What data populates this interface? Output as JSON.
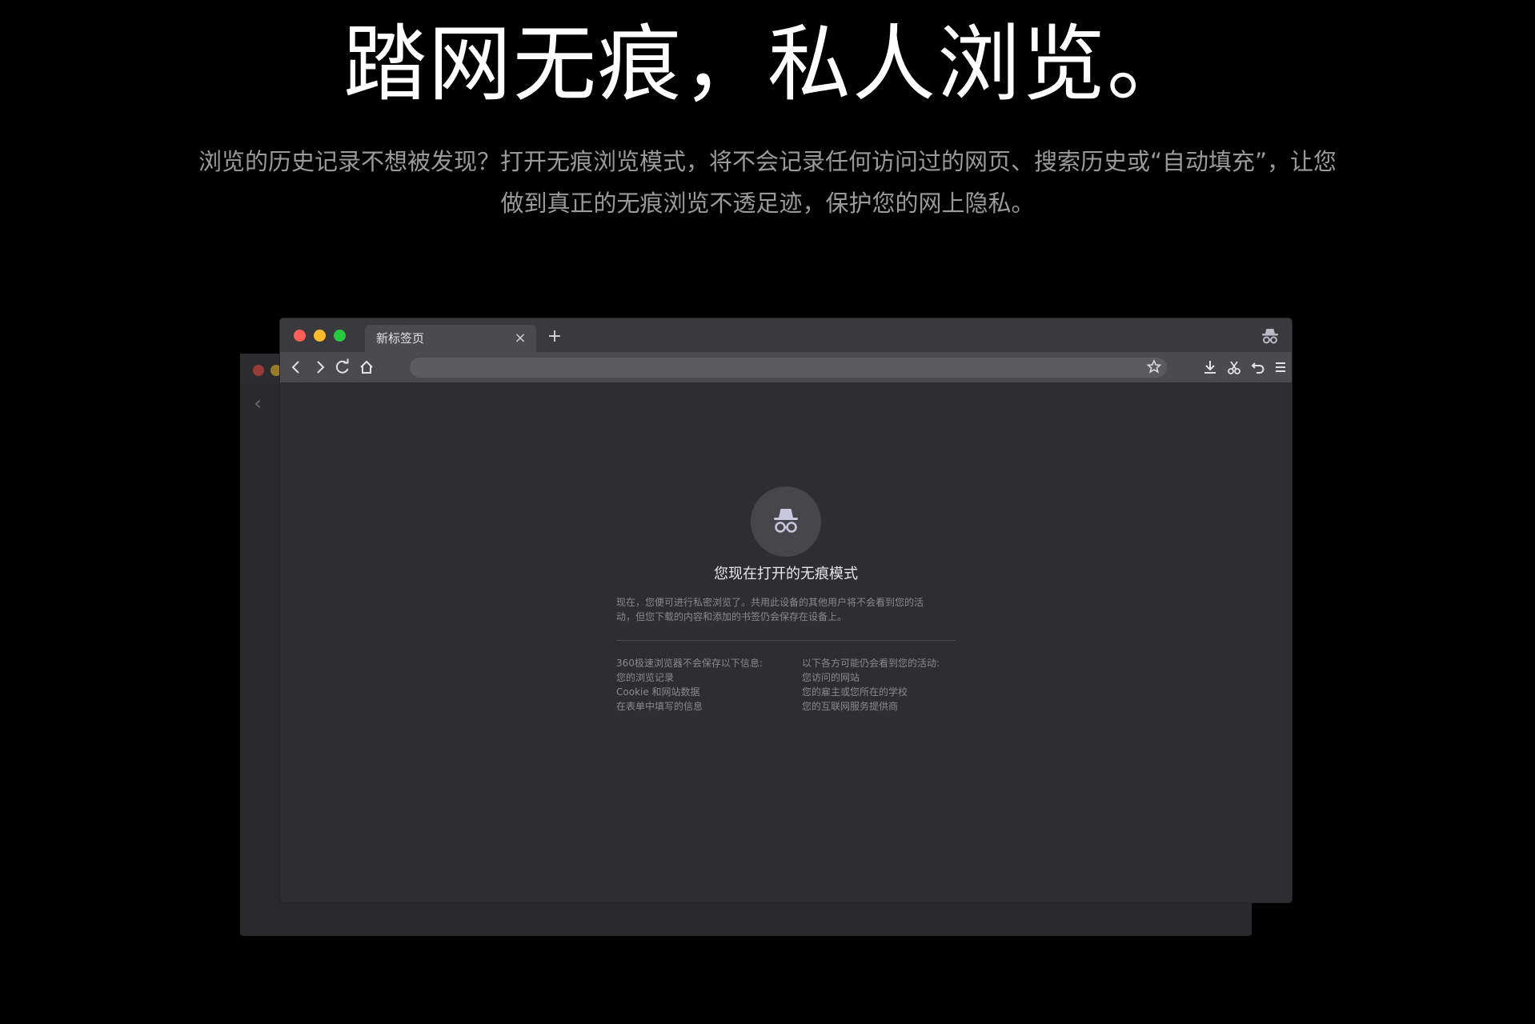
{
  "hero": {
    "headline": "踏网无痕，私人浏览。",
    "subtitle_line1": "浏览的历史记录不想被发现？打开无痕浏览模式，将不会记录任何访问过的网页、搜索历史或“自动填充”，让您",
    "subtitle_line2": "做到真正的无痕浏览不透足迹，保护您的网上隐私。"
  },
  "browser": {
    "tab_title": "新标签页",
    "colors": {
      "close": "#ff5f57",
      "minimize": "#febc2e",
      "maximize": "#28c840",
      "window_bg": "#2e2e31",
      "toolbar_bg": "#4a4a4f"
    }
  },
  "incognito": {
    "title": "您现在打开的无痕模式",
    "description_line1": "现在，您便可进行私密浏览了。共用此设备的其他用户将不会看到您的活",
    "description_line2": "动，但您下载的内容和添加的书签仍会保存在设备上。",
    "not_saved": {
      "heading": "360极速浏览器不会保存以下信息:",
      "items": [
        "您的浏览记录",
        "Cookie 和网站数据",
        "在表单中填写的信息"
      ]
    },
    "may_see": {
      "heading": "以下各方可能仍会看到您的活动:",
      "items": [
        "您访问的网站",
        "您的雇主或您所在的学校",
        "您的互联网服务提供商"
      ]
    }
  }
}
